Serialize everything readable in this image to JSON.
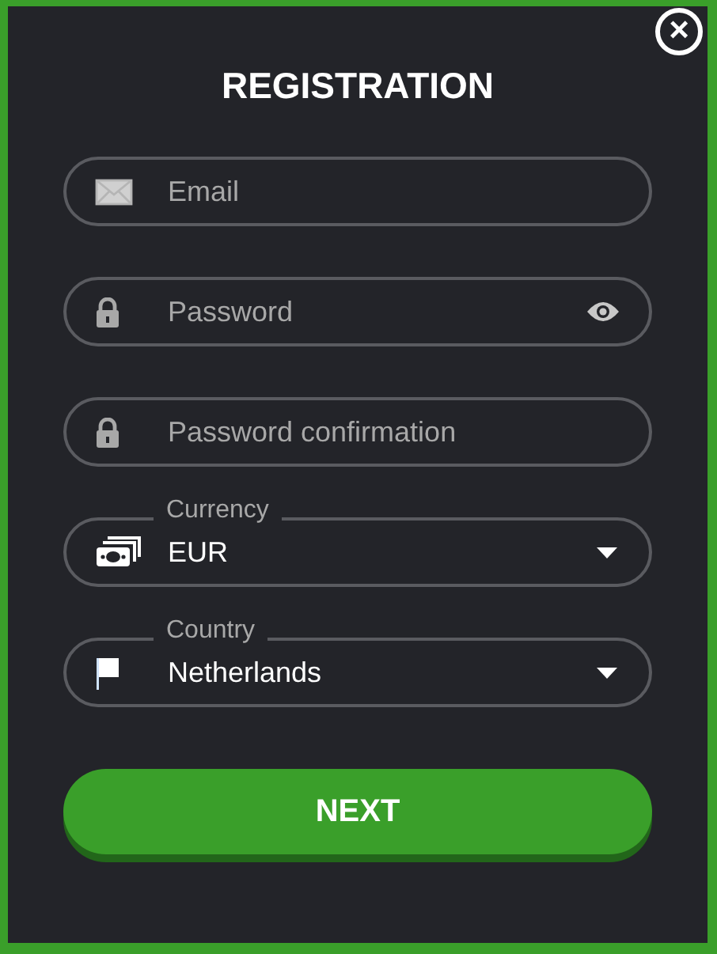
{
  "title": "REGISTRATION",
  "close_button": {
    "label": "×"
  },
  "fields": [
    {
      "kind": "email",
      "placeholder": "Email"
    },
    {
      "kind": "password",
      "placeholder": "Password",
      "show_toggle": true
    },
    {
      "kind": "password",
      "placeholder": "Password confirmation",
      "show_toggle": false
    },
    {
      "kind": "currency",
      "label": "Currency",
      "value": "EUR"
    },
    {
      "kind": "country",
      "label": "Country",
      "value": "Netherlands"
    }
  ],
  "submit_button": {
    "label": "NEXT"
  }
}
